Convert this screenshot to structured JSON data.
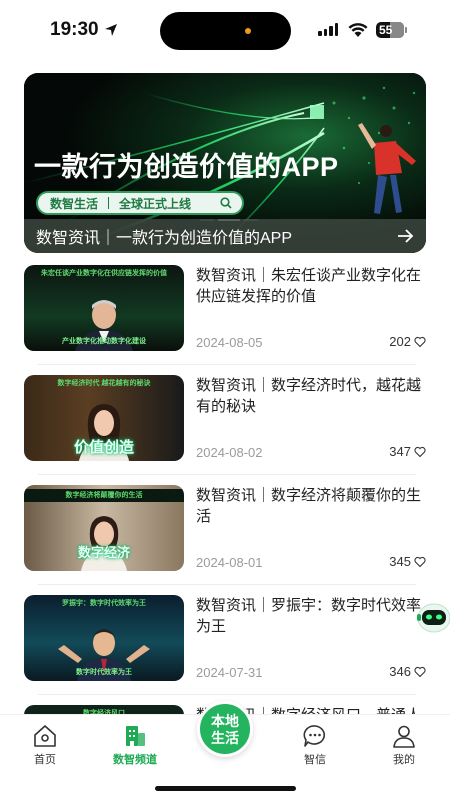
{
  "status_bar": {
    "time": "19:30",
    "battery": "55"
  },
  "banner": {
    "headline": "一款行为创造价值的APP",
    "pill_left": "数智生活",
    "pill_right": "全球正式上线",
    "caption": "数智资讯｜一款行为创造价值的APP"
  },
  "news": [
    {
      "title": "数智资讯｜朱宏任谈产业数字化在供应链发挥的价值",
      "date": "2024-08-05",
      "likes": "202",
      "thumb_title": "朱宏任谈产业数字化在供应链发挥的价值",
      "thumb_caption": "产业数字化推动数字化建设"
    },
    {
      "title": "数智资讯｜数字经济时代，越花越有的秘诀",
      "date": "2024-08-02",
      "likes": "347",
      "thumb_title": "数字经济时代 越花越有的秘诀",
      "thumb_overlay": "价值创造"
    },
    {
      "title": "数智资讯｜数字经济将颠覆你的生活",
      "date": "2024-08-01",
      "likes": "345",
      "thumb_title": "数字经济将颠覆你的生活",
      "thumb_overlay": "数字经济"
    },
    {
      "title": "数智资讯｜罗振宇：数字时代效率为王",
      "date": "2024-07-31",
      "likes": "346",
      "thumb_title": "罗振宇：数字时代效率为王",
      "thumb_caption": "数字时代效率为王"
    },
    {
      "title": "数智资讯｜数字经济风口，普通人",
      "thumb_title": "数字经济风口"
    }
  ],
  "tabbar": {
    "home": "首页",
    "channel": "数智频道",
    "center": "本地生活",
    "message": "智信",
    "mine": "我的"
  },
  "colors": {
    "accent": "#1faa55",
    "neon": "#22e06a"
  }
}
